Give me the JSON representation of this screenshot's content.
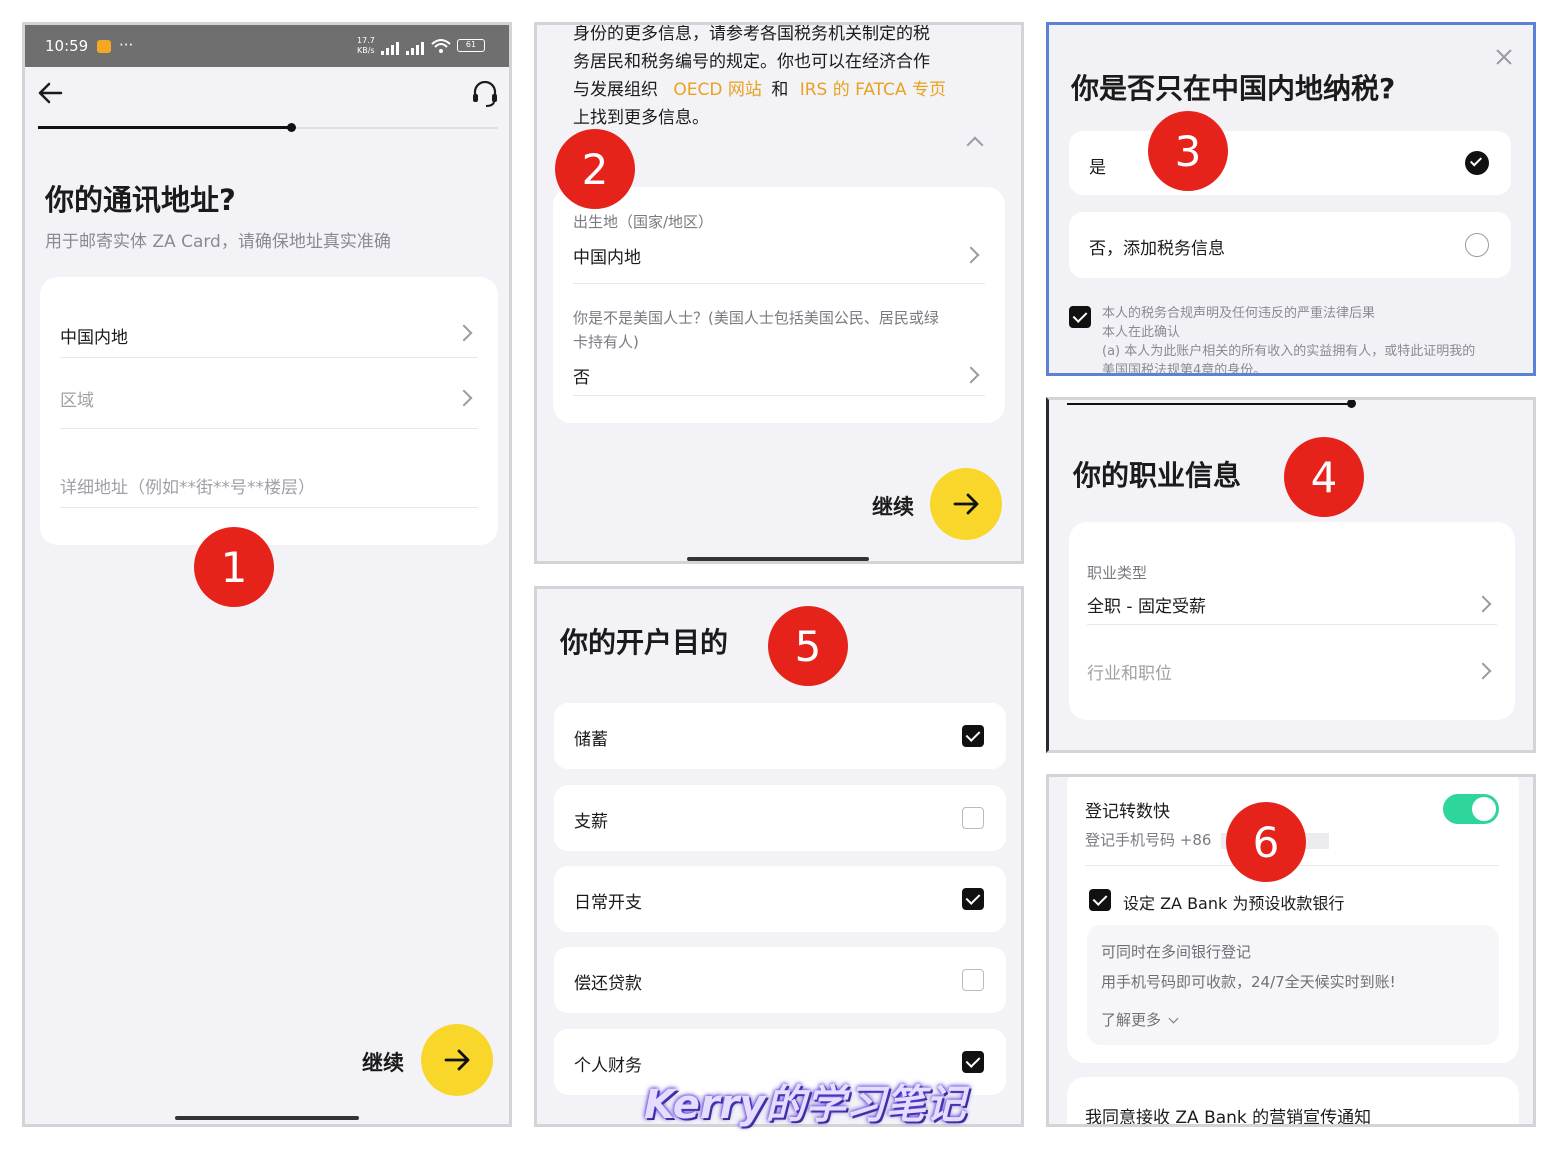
{
  "p1": {
    "status_time": "10:59",
    "status_dots": "···",
    "net_speed_num": "17.7",
    "net_speed_unit": "KB/s",
    "battery": "61",
    "title": "你的通讯地址?",
    "subtitle": "用于邮寄实体 ZA Card，请确保地址真实准确",
    "region_value": "中国内地",
    "district_placeholder": "区域",
    "address_placeholder": "详细地址（例如**街**号**楼层）",
    "continue_label": "继续",
    "progress": 0.55
  },
  "p2": {
    "para_line1": "身份的更多信息，请参考各国税务机关制定的税",
    "para_line2": "务居民和税务编号的规定。你也可以在经济合作",
    "para_line3_a": "与发展组织",
    "para_link_oecd": "OECD 网站",
    "para_and": "和",
    "para_link_irs": "IRS 的 FATCA 专页",
    "para_line4": "上找到更多信息。",
    "birthplace_label": "出生地（国家/地区）",
    "birthplace_value": "中国内地",
    "us_person_question_line1": "你是不是美国人士？(美国人士包括美国公民、居民或绿",
    "us_person_question_line2": "卡持有人)",
    "us_person_answer": "否",
    "continue_label": "继续"
  },
  "p3": {
    "title": "你是否只在中国内地纳税?",
    "option_yes": "是",
    "option_no": "否，添加税务信息",
    "declaration_line1": "本人的税务合规声明及任何违反的严重法律后果",
    "declaration_line2": "本人在此确认",
    "declaration_line3": "(a) 本人为此账户相关的所有收入的实益拥有人，或特此证明我的",
    "declaration_line4": "美国国税法规第4章的身份。"
  },
  "p4": {
    "title": "你的职业信息",
    "job_type_label": "职业类型",
    "job_type_value": "全职 - 固定受薪",
    "industry_placeholder": "行业和职位"
  },
  "p5": {
    "title": "你的开户目的",
    "options": [
      {
        "label": "储蓄",
        "checked": true
      },
      {
        "label": "支薪",
        "checked": false
      },
      {
        "label": "日常开支",
        "checked": true
      },
      {
        "label": "偿还贷款",
        "checked": false
      },
      {
        "label": "个人财务",
        "checked": true
      }
    ]
  },
  "p6": {
    "fps_title": "登记转数快",
    "fps_phone_label": "登记手机号码 +86",
    "default_bank_label": "设定 ZA Bank 为预设收款银行",
    "info_line1": "可同时在多间银行登记",
    "info_line2": "用手机号码即可收款，24/7全天候实时到账!",
    "learn_more": "了解更多",
    "marketing_consent": "我同意接收 ZA Bank 的营销宣传通知"
  },
  "badges": [
    "1",
    "2",
    "3",
    "4",
    "5",
    "6"
  ],
  "watermark": "Kerry的学习笔记",
  "colors": {
    "accent_yellow": "#f8d72a",
    "link_orange": "#e9a21e",
    "badge_red": "#e5231b",
    "toggle_green": "#2ed69b",
    "highlight_blue": "#5b82d6"
  }
}
